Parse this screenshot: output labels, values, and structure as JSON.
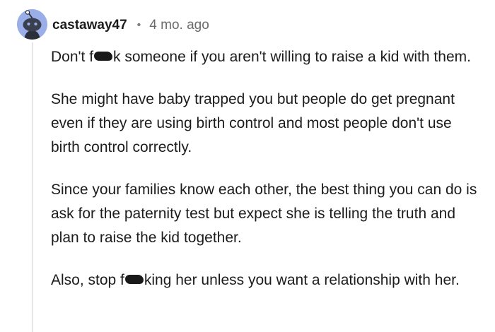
{
  "comment": {
    "author": "castaway47",
    "separator": "•",
    "timestamp": "4 mo. ago",
    "avatar_icon": "reddit-snoo-avatar-icon",
    "paragraphs": [
      {
        "before": "Don't f",
        "after": "k someone if you aren't willing to raise a kid with them."
      },
      {
        "text": "She might have baby trapped you but people do get pregnant even if they are using birth control and most people don't use birth control correctly."
      },
      {
        "text": "Since your families know each other, the best thing you can do is ask for the paternity test but expect she is telling the truth and plan to raise the kid together."
      },
      {
        "before": "Also, stop f",
        "after": "king her unless you want a relationship with her."
      }
    ]
  },
  "colors": {
    "avatar_bg": "#9aaee8",
    "text": "#1c1c1c",
    "meta_text": "#6b6b6b",
    "thread_line": "#e6e6e6"
  }
}
